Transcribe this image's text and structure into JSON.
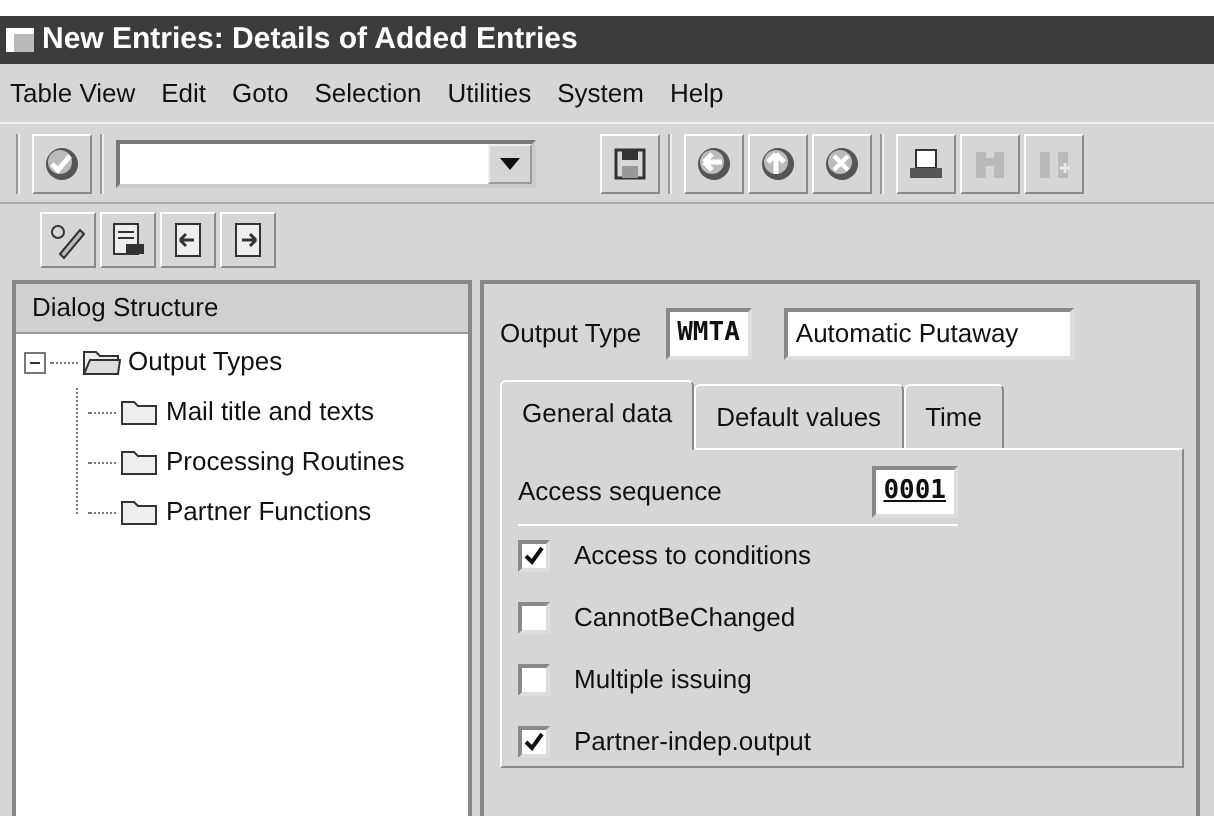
{
  "window": {
    "title": "New Entries: Details of Added Entries"
  },
  "menu": [
    "Table View",
    "Edit",
    "Goto",
    "Selection",
    "Utilities",
    "System",
    "Help"
  ],
  "toolbar_groups": [
    [
      {
        "kind": "enter",
        "disabled": false
      }
    ],
    [
      {
        "kind": "command-field"
      },
      {
        "kind": "save",
        "disabled": false
      }
    ],
    [
      {
        "kind": "back",
        "disabled": false
      },
      {
        "kind": "exit",
        "disabled": false
      },
      {
        "kind": "cancel",
        "disabled": false
      }
    ],
    [
      {
        "kind": "print",
        "disabled": false
      },
      {
        "kind": "find",
        "disabled": true
      },
      {
        "kind": "find-next",
        "disabled": true
      }
    ]
  ],
  "app_toolbar": [
    {
      "kind": "display-change"
    },
    {
      "kind": "details"
    },
    {
      "kind": "previous"
    },
    {
      "kind": "next"
    }
  ],
  "dialog_structure": {
    "title": "Dialog Structure",
    "items": [
      {
        "label": "Output Types",
        "expanded": true,
        "children": [
          {
            "label": "Mail title and texts"
          },
          {
            "label": "Processing Routines"
          },
          {
            "label": "Partner Functions"
          }
        ]
      }
    ]
  },
  "output_type": {
    "label": "Output Type",
    "code": "WMTA",
    "description": "Automatic Putaway"
  },
  "tabs": [
    {
      "label": "General data",
      "selected": true
    },
    {
      "label": "Default values",
      "selected": false
    },
    {
      "label": "Time",
      "selected": false
    }
  ],
  "access_sequence": {
    "label": "Access sequence",
    "value": "0001"
  },
  "options": [
    {
      "label": "Access to conditions",
      "checked": true
    },
    {
      "label": "CannotBeChanged",
      "checked": false
    },
    {
      "label": "Multiple issuing",
      "checked": false
    },
    {
      "label": "Partner-indep.output",
      "checked": true
    }
  ]
}
